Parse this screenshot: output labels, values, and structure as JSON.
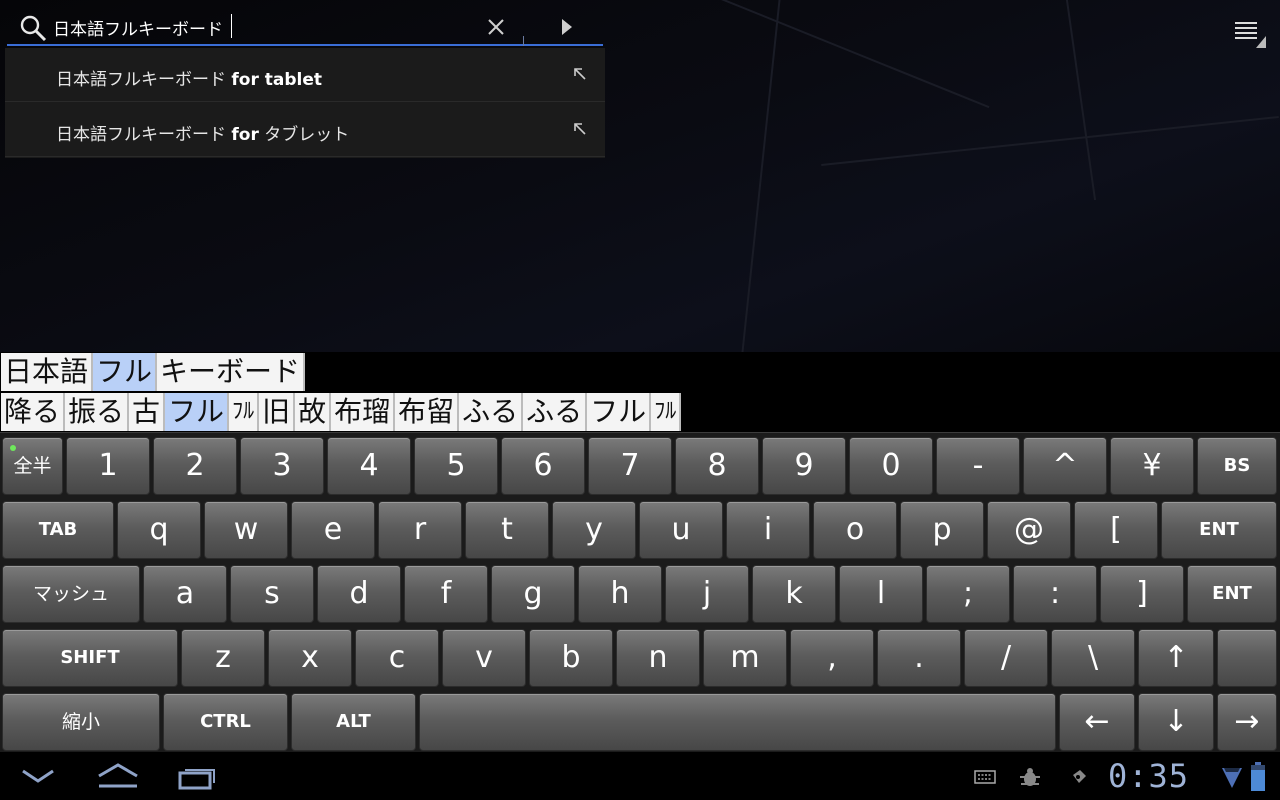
{
  "search": {
    "value": "日本語フルキーボード",
    "placeholder": ""
  },
  "suggestions": [
    {
      "prefix": "日本語フルキーボード ",
      "emphasis": "for tablet"
    },
    {
      "prefix": "日本語フルキーボード ",
      "emphasis": "for",
      "suffix": " タブレット"
    }
  ],
  "candidates_row1": [
    {
      "text": "日本語",
      "selected": false
    },
    {
      "text": "フル",
      "selected": true
    },
    {
      "text": "キーボード",
      "selected": false
    }
  ],
  "candidates_row2": [
    {
      "text": "降る",
      "selected": false
    },
    {
      "text": "振る",
      "selected": false
    },
    {
      "text": "古",
      "selected": false
    },
    {
      "text": "フル",
      "selected": true
    },
    {
      "text": "ﾌﾙ",
      "selected": false
    },
    {
      "text": "旧",
      "selected": false
    },
    {
      "text": "故",
      "selected": false
    },
    {
      "text": "布瑠",
      "selected": false
    },
    {
      "text": "布留",
      "selected": false
    },
    {
      "text": "ふる",
      "selected": false
    },
    {
      "text": "ふる",
      "selected": false
    },
    {
      "text": "フル",
      "selected": false
    },
    {
      "text": "ﾌﾙ",
      "selected": false
    }
  ],
  "keyboard": {
    "row1": [
      "全半",
      "1",
      "2",
      "3",
      "4",
      "5",
      "6",
      "7",
      "8",
      "9",
      "0",
      "-",
      "^",
      "¥",
      "BS"
    ],
    "row2": [
      "TAB",
      "q",
      "w",
      "e",
      "r",
      "t",
      "y",
      "u",
      "i",
      "o",
      "p",
      "@",
      "[",
      "ENT"
    ],
    "row3": [
      "マッシュ",
      "a",
      "s",
      "d",
      "f",
      "g",
      "h",
      "j",
      "k",
      "l",
      ";",
      ":",
      "]",
      "ENT"
    ],
    "row4": [
      "SHIFT",
      "z",
      "x",
      "c",
      "v",
      "b",
      "n",
      "m",
      ",",
      ".",
      "/",
      "\\",
      "↑",
      ""
    ],
    "row5": [
      "縮小",
      "CTRL",
      "ALT",
      "",
      "←",
      "↓",
      "→"
    ]
  },
  "status": {
    "clock": "0:35"
  },
  "colors": {
    "accent": "#3a6dd6",
    "candidate_selected": "#b9d0f7",
    "clock": "#9fb3d6"
  }
}
